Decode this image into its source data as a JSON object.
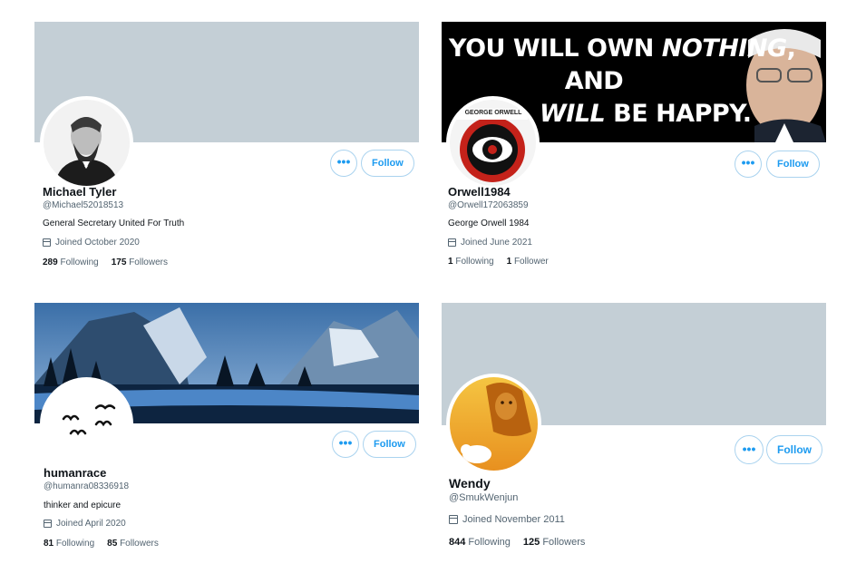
{
  "profiles": [
    {
      "name": "Michael Tyler",
      "handle": "@Michael52018513",
      "bio": "General Secretary United For Truth",
      "joined": "Joined October 2020",
      "following_count": "289",
      "following_label": "Following",
      "followers_count": "175",
      "followers_label": "Followers",
      "more_label": "•••",
      "follow_label": "Follow"
    },
    {
      "name": "Orwell1984",
      "handle": "@Orwell172063859",
      "bio": "George Orwell 1984",
      "joined": "Joined June 2021",
      "following_count": "1",
      "following_label": "Following",
      "followers_count": "1",
      "followers_label": "Follower",
      "more_label": "•••",
      "follow_label": "Follow",
      "banner_line1_a": "YOU WILL OWN ",
      "banner_line1_b": "NOTHING",
      "banner_line1_c": ",",
      "banner_line2": "AND",
      "banner_line3_a": "WILL",
      "banner_line3_b": " BE HAPPY.",
      "avatar_text": "GEORGE ORWELL"
    },
    {
      "name": "humanrace",
      "handle": "@humanra08336918",
      "bio": "thinker and epicure",
      "joined": "Joined April 2020",
      "following_count": "81",
      "following_label": "Following",
      "followers_count": "85",
      "followers_label": "Followers",
      "more_label": "•••",
      "follow_label": "Follow"
    },
    {
      "name": "Wendy",
      "handle": "@SmukWenjun",
      "joined": "Joined November 2011",
      "following_count": "844",
      "following_label": "Following",
      "followers_count": "125",
      "followers_label": "Followers",
      "more_label": "•••",
      "follow_label": "Follow"
    }
  ],
  "icons": {
    "calendar": "calendar-icon",
    "more": "more-icon"
  },
  "colors": {
    "accent": "#1d9bf0",
    "banner_plain": "#c4cfd6",
    "muted_text": "#536471",
    "text": "#0f1419"
  }
}
